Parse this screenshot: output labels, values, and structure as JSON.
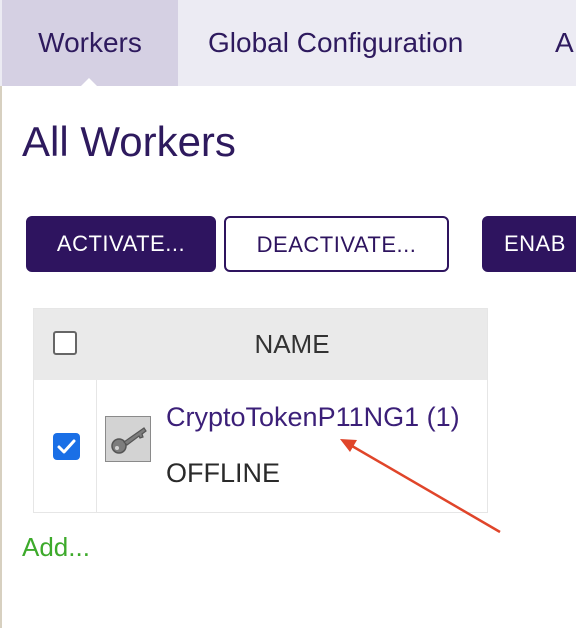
{
  "tabs": [
    {
      "label": "Workers",
      "active": true
    },
    {
      "label": "Global Configuration",
      "active": false
    },
    {
      "label": "A",
      "active": false
    }
  ],
  "page_title": "All Workers",
  "toolbar": {
    "activate_label": "ACTIVATE...",
    "deactivate_label": "DEACTIVATE...",
    "enable_label": "ENAB"
  },
  "table": {
    "header_name": "NAME",
    "rows": [
      {
        "name": "CryptoTokenP11NG1 (1)",
        "status": "OFFLINE",
        "selected": true,
        "icon": "key-icon"
      }
    ]
  },
  "add_link": "Add...",
  "colors": {
    "primary": "#2e145f",
    "link": "#3b1f78",
    "add_link": "#3daa2b",
    "checkbox": "#1a6fe6",
    "annotation_arrow": "#e0452a"
  }
}
